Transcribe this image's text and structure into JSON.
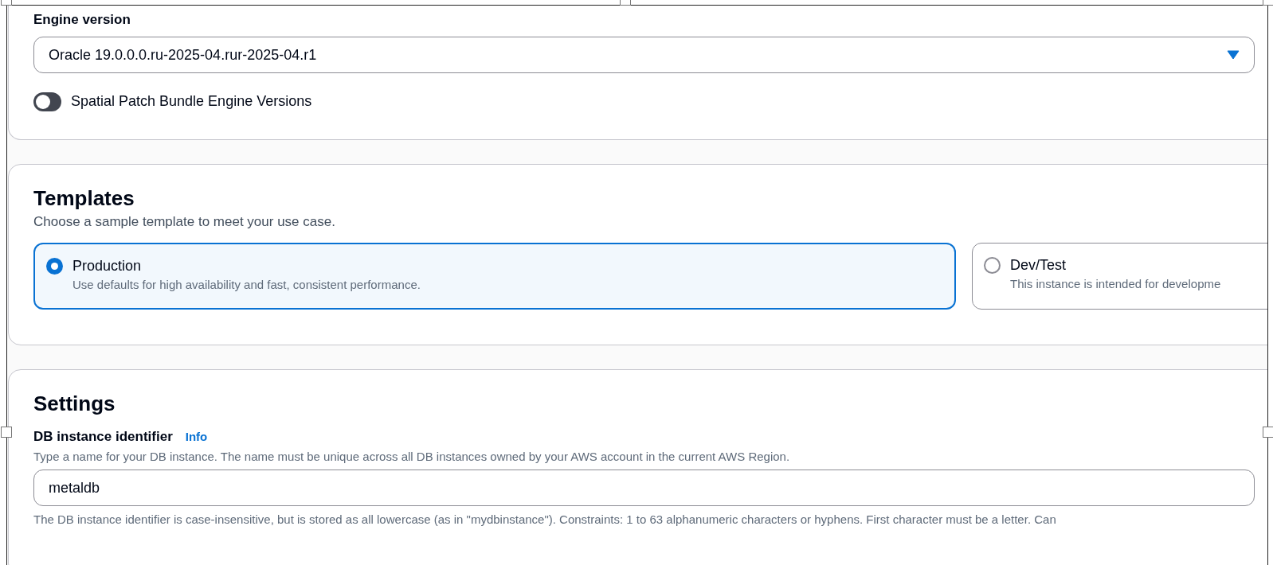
{
  "engine_version": {
    "label": "Engine version",
    "value": "Oracle 19.0.0.0.ru-2025-04.rur-2025-04.r1",
    "toggle": {
      "label": "Spatial Patch Bundle Engine Versions",
      "on": false
    }
  },
  "templates": {
    "title": "Templates",
    "description": "Choose a sample template to meet your use case.",
    "options": [
      {
        "title": "Production",
        "description": "Use defaults for high availability and fast, consistent performance.",
        "selected": true
      },
      {
        "title": "Dev/Test",
        "description": "This instance is intended for developme",
        "selected": false
      }
    ]
  },
  "settings": {
    "title": "Settings",
    "field": {
      "label": "DB instance identifier",
      "info_link": "Info",
      "hint": "Type a name for your DB instance. The name must be unique across all DB instances owned by your AWS account in the current AWS Region.",
      "value": "metaldb",
      "constraint": "The DB instance identifier is case-insensitive, but is stored as all lowercase (as in \"mydbinstance\"). Constraints: 1 to 63 alphanumeric characters or hyphens. First character must be a letter. Can"
    }
  }
}
